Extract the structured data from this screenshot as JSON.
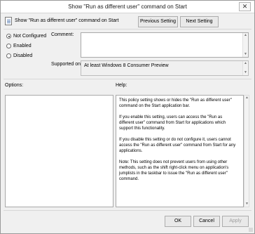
{
  "window": {
    "title": "Show \"Run as different user\" command on Start",
    "close_glyph": "✕"
  },
  "header": {
    "policy_name": "Show \"Run as different user\" command on Start",
    "prev_button": "Previous Setting",
    "next_button": "Next Setting"
  },
  "state": {
    "options": [
      {
        "label": "Not Configured",
        "checked": true
      },
      {
        "label": "Enabled",
        "checked": false
      },
      {
        "label": "Disabled",
        "checked": false
      }
    ]
  },
  "fields": {
    "comment_label": "Comment:",
    "comment_value": "",
    "supported_label": "Supported on:",
    "supported_value": "At least Windows 8 Consumer Preview"
  },
  "sections": {
    "options_label": "Options:",
    "help_label": "Help:"
  },
  "help": {
    "paragraphs": [
      "This policy setting shows or hides the \"Run as different user\" command on the Start application bar.",
      "If you enable this setting, users can access the \"Run as different user\" command from Start for applications which support this functionality.",
      "If you disable this setting or do not configure it, users cannot access the \"Run as different user\" command from Start for any applications.",
      "Note: This setting does not prevent users from using other methods, such as the shift right-click menu on application's jumplists in the taskbar to issue the \"Run as different user\" command."
    ]
  },
  "footer": {
    "ok_button": "OK",
    "cancel_button": "Cancel",
    "apply_button": "Apply"
  }
}
